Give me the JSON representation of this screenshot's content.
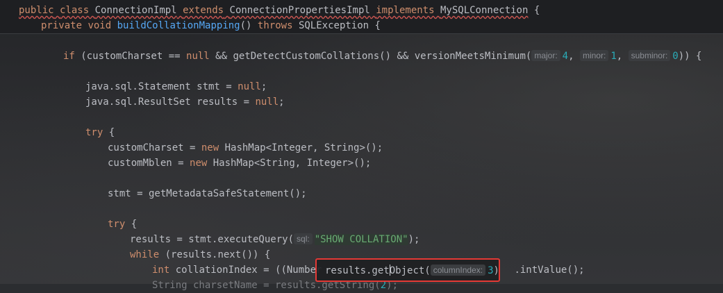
{
  "sticky": {
    "line1": {
      "kw_public": "public",
      "kw_class": "class",
      "class_name": "ConnectionImpl",
      "kw_extends": "extends",
      "parent": "ConnectionPropertiesImpl",
      "kw_implements": "implements",
      "iface": "MySQLConnection",
      "brace": "{"
    },
    "line2": {
      "kw_private": "private",
      "kw_void": "void",
      "method": "buildCollationMapping",
      "parens": "()",
      "kw_throws": "throws",
      "exc": "SQLException",
      "brace": "{"
    }
  },
  "code": {
    "l1": {
      "kw_if": "if",
      "pre": " (customCharset == ",
      "null": "null",
      "mid": " && getDetectCustomCollations() && versionMeetsMinimum(",
      "hint_major": "major:",
      "v_major": "4",
      "sep1": ", ",
      "hint_minor": "minor:",
      "v_minor": "1",
      "sep2": ", ",
      "hint_subminor": "subminor:",
      "v_subminor": "0",
      "end": ")) {"
    },
    "l2": {
      "pre": "java.sql.Statement stmt = ",
      "null": "null",
      "end": ";"
    },
    "l3": {
      "pre": "java.sql.ResultSet results = ",
      "null": "null",
      "end": ";"
    },
    "l4": {
      "kw_try": "try",
      "end": " {"
    },
    "l5": {
      "pre": "customCharset = ",
      "kw_new": "new",
      "end": " HashMap<Integer, String>();"
    },
    "l6": {
      "pre": "customMblen = ",
      "kw_new": "new",
      "end": " HashMap<String, Integer>();"
    },
    "l7": {
      "text": "stmt = getMetadataSafeStatement();"
    },
    "l8": {
      "kw_try": "try",
      "end": " {"
    },
    "l9": {
      "pre": "results = stmt.executeQuery(",
      "hint_sql": "sql:",
      "str": "\"SHOW COLLATION\"",
      "end": ");"
    },
    "l10": {
      "kw_while": "while",
      "end": " (results.next()) {"
    },
    "l11": {
      "kw_int": "int",
      "pre": " collationIndex = ((Number",
      "end": ".intValue();"
    },
    "l12": {
      "text": "String charsetName = results.getString(",
      "num": "2",
      "end": ");"
    }
  },
  "popup": {
    "pre": "results.get",
    "post": "bject(",
    "caret_char": "O",
    "hint": "columnIndex:",
    "value": "3",
    "end": ")"
  }
}
